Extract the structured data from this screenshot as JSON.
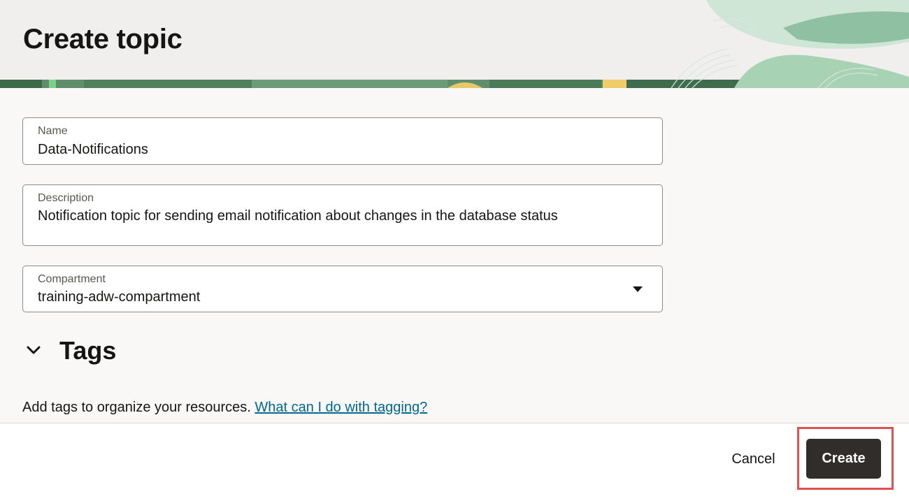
{
  "header": {
    "title": "Create topic"
  },
  "form": {
    "name": {
      "label": "Name",
      "value": "Data-Notifications"
    },
    "description": {
      "label": "Description",
      "value": "Notification topic for sending email notification about changes in the database status"
    },
    "compartment": {
      "label": "Compartment",
      "value": "training-adw-compartment"
    }
  },
  "tags": {
    "title": "Tags",
    "help_text": "Add tags to organize your resources. ",
    "help_link": "What can I do with tagging?"
  },
  "footer": {
    "cancel_label": "Cancel",
    "create_label": "Create"
  },
  "colors": {
    "primary_button": "#312d2a",
    "link": "#00688c",
    "highlight": "#e05252",
    "header_bg": "#f1efed"
  },
  "icons": {
    "tags_toggle": "chevron-down-icon",
    "compartment_caret": "caret-down-icon"
  }
}
